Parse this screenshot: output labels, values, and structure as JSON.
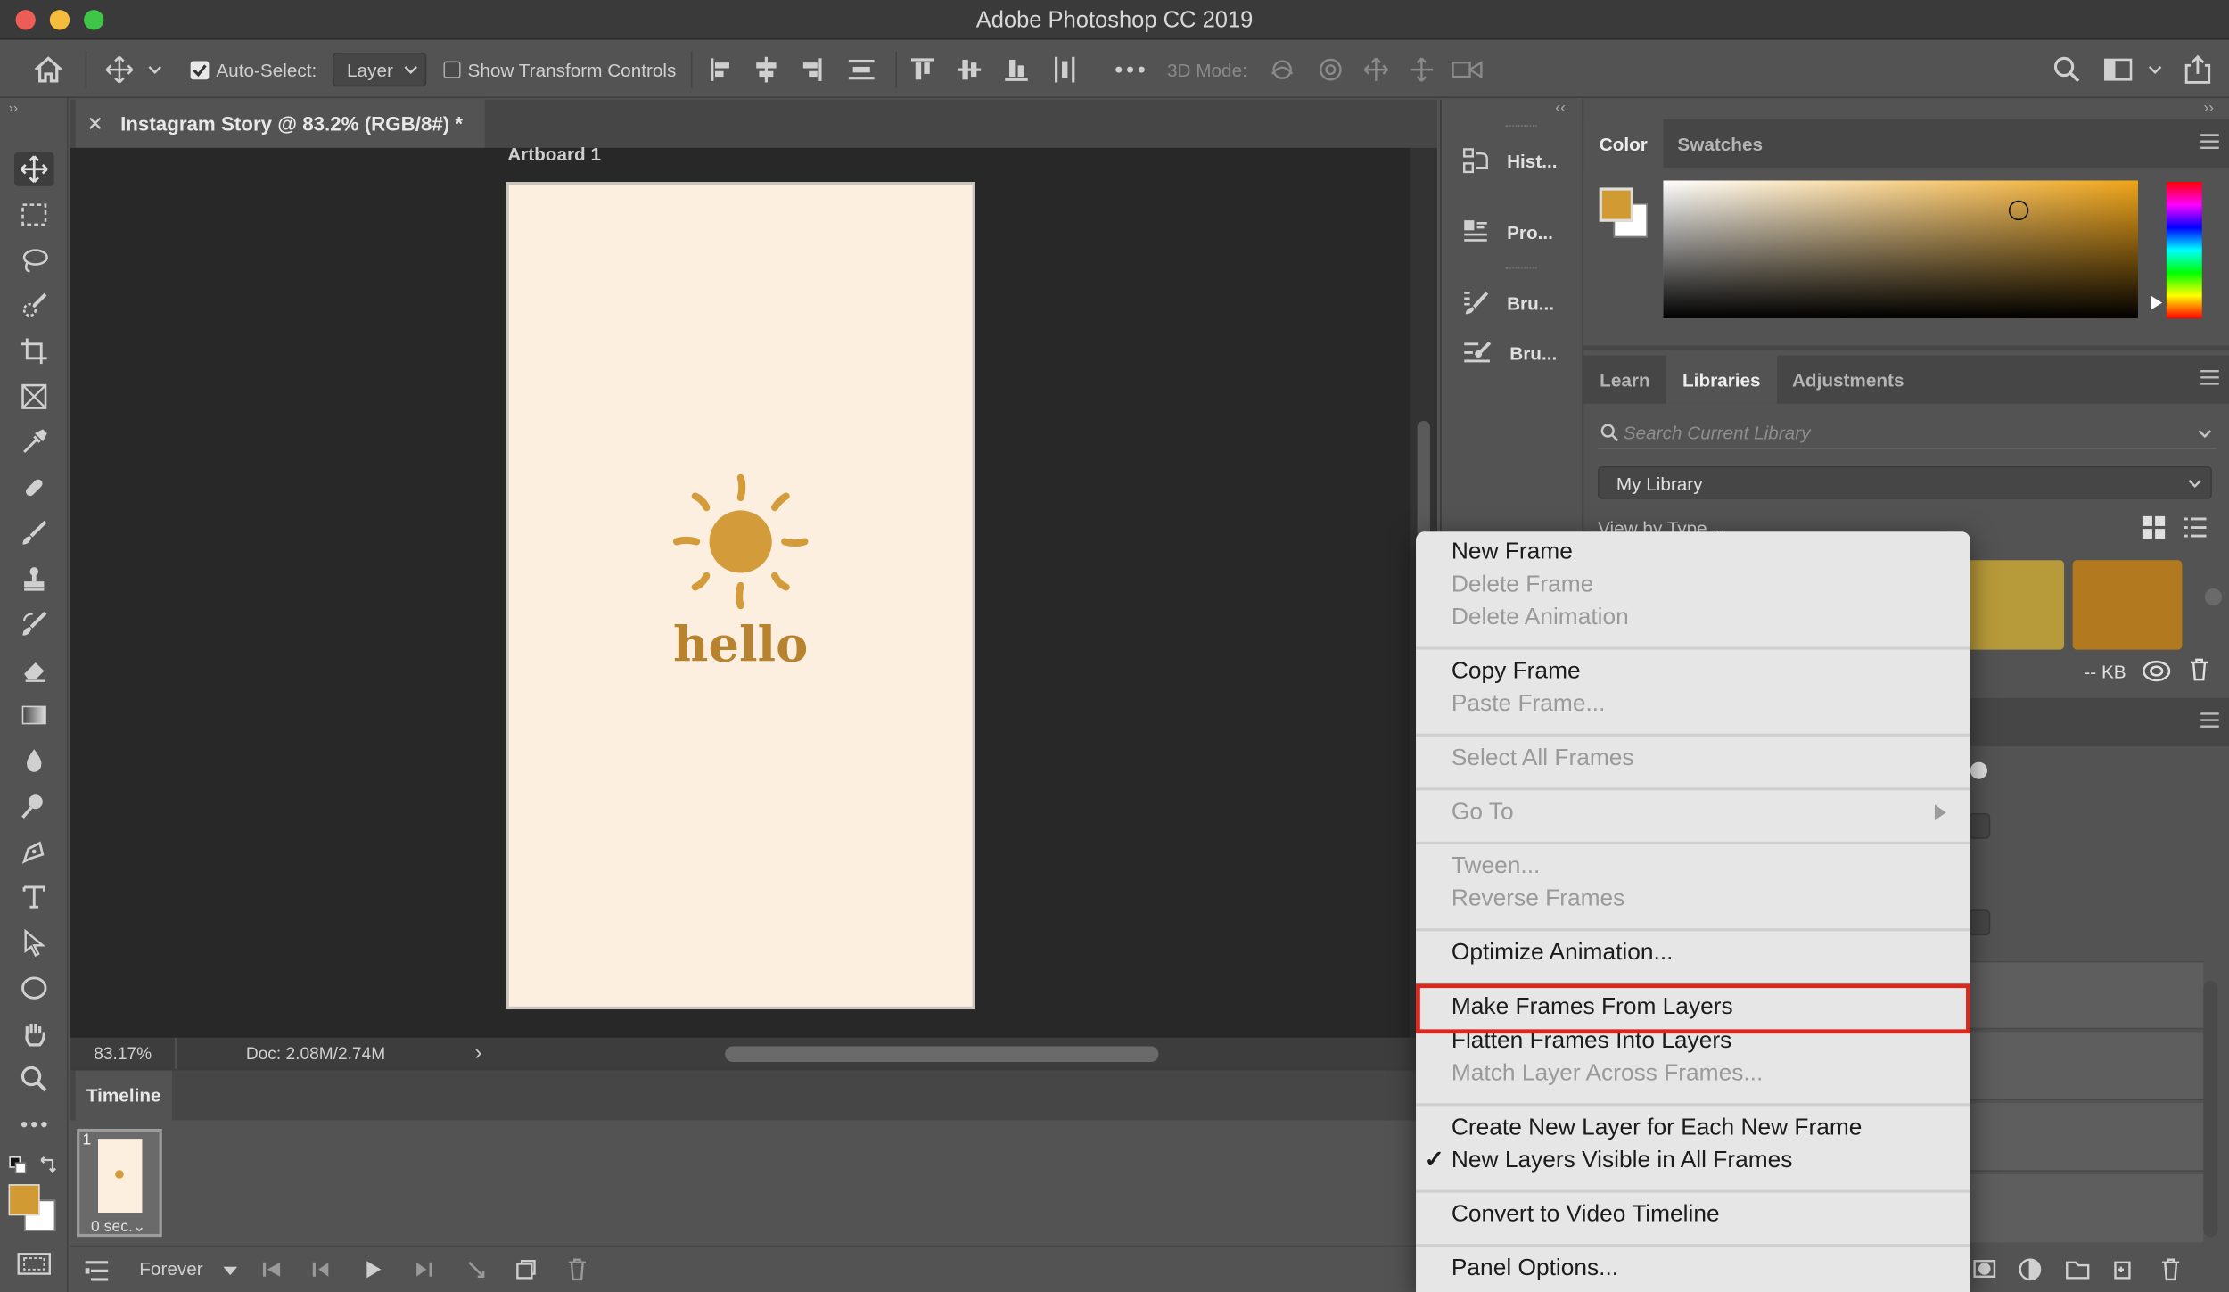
{
  "window": {
    "title": "Adobe Photoshop CC 2019"
  },
  "options_bar": {
    "auto_select_label": "Auto-Select:",
    "auto_select_target": "Layer",
    "show_transform_label": "Show Transform Controls",
    "mode_3d_label": "3D Mode:"
  },
  "document": {
    "tab_title": "Instagram Story @ 83.2% (RGB/8#) *",
    "artboard_name": "Artboard 1",
    "artboard_text": "hello",
    "zoom": "83.17%",
    "doc_size": "Doc: 2.08M/2.74M"
  },
  "timeline": {
    "title": "Timeline",
    "frame_number": "1",
    "frame_delay": "0 sec.",
    "loop": "Forever"
  },
  "dock": {
    "items": [
      {
        "label": "Hist..."
      },
      {
        "label": "Pro..."
      },
      {
        "label": "Bru..."
      },
      {
        "label": "Bru..."
      }
    ]
  },
  "color_panel": {
    "tabs": [
      "Color",
      "Swatches"
    ],
    "foreground": "#d19a32",
    "background": "#ffffff"
  },
  "libraries_panel": {
    "tabs": [
      "Learn",
      "Libraries",
      "Adjustments"
    ],
    "search_placeholder": "Search Current Library",
    "library_name": "My Library",
    "view_by": "View by Type",
    "size_text": "-- KB",
    "swatch_colors": [
      "#b79a39",
      "#b3791f"
    ]
  },
  "context_menu": {
    "items": [
      {
        "label": "New Frame",
        "enabled": true
      },
      {
        "label": "Delete Frame",
        "enabled": false
      },
      {
        "label": "Delete Animation",
        "enabled": false
      },
      {
        "label": "Copy Frame",
        "enabled": true
      },
      {
        "label": "Paste Frame...",
        "enabled": false
      },
      {
        "label": "Select All Frames",
        "enabled": false
      },
      {
        "label": "Go To",
        "enabled": false
      },
      {
        "label": "Tween...",
        "enabled": false
      },
      {
        "label": "Reverse Frames",
        "enabled": false
      },
      {
        "label": "Optimize Animation...",
        "enabled": true
      },
      {
        "label": "Make Frames From Layers",
        "enabled": true,
        "highlighted": true
      },
      {
        "label": "Flatten Frames Into Layers",
        "enabled": true
      },
      {
        "label": "Match Layer Across Frames...",
        "enabled": false
      },
      {
        "label": "Create New Layer for Each New Frame",
        "enabled": true
      },
      {
        "label": "New Layers Visible in All Frames",
        "enabled": true,
        "checked": true
      },
      {
        "label": "Convert to Video Timeline",
        "enabled": true
      },
      {
        "label": "Panel Options...",
        "enabled": true
      }
    ],
    "highlight_color": "#d62a1e"
  },
  "colors": {
    "sun": "#d39b3a",
    "artboard_bg": "#fdefe0"
  }
}
